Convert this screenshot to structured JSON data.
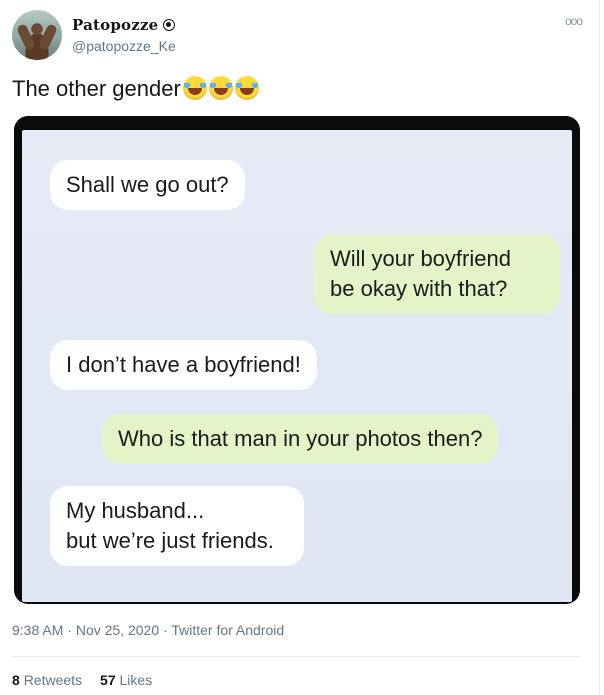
{
  "tweet": {
    "author": {
      "display_name": "Patopozze",
      "handle": "@patopozze_Ke"
    },
    "text": "The other gender",
    "emoji": [
      "face-with-tears-of-joy-icon",
      "face-with-tears-of-joy-icon",
      "face-with-tears-of-joy-icon"
    ],
    "media": {
      "messages": [
        {
          "side": "incoming",
          "text": "Shall we go out?"
        },
        {
          "side": "outgoing",
          "lines": [
            "Will your boyfriend",
            "be okay with that?"
          ]
        },
        {
          "side": "incoming",
          "text": "I don’t have a boyfriend!"
        },
        {
          "side": "outgoing",
          "text": "Who is that man in your photos then?"
        },
        {
          "side": "incoming",
          "lines": [
            "My husband...",
            "but we’re just friends."
          ]
        }
      ]
    },
    "meta": {
      "time": "9:38 AM",
      "date": "Nov 25, 2020",
      "source": "Twitter for Android",
      "separator": " · "
    },
    "stats": {
      "retweets_count": "8",
      "retweets_label": "Retweets",
      "likes_count": "57",
      "likes_label": "Likes"
    }
  },
  "colors": {
    "outgoing_bubble": "#e4f4c8",
    "incoming_bubble": "#ffffff",
    "chat_background": "#e3e8f5",
    "secondary_text": "#657786"
  }
}
